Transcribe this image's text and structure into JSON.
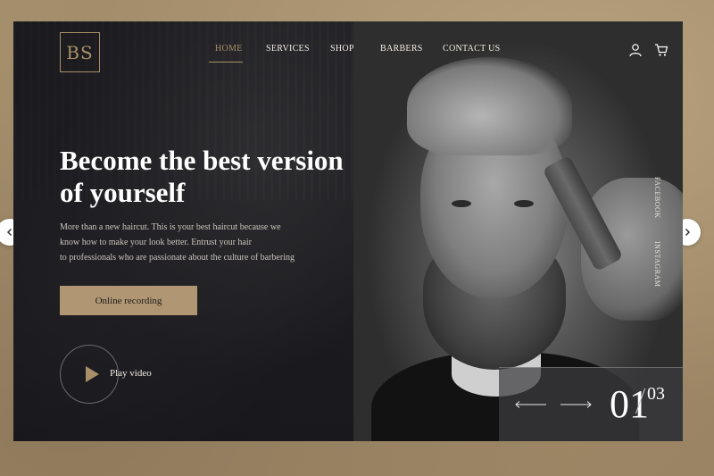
{
  "brand": {
    "logo_text": "BS"
  },
  "nav": {
    "items": [
      {
        "label": "HOME",
        "active": true
      },
      {
        "label": "SERVICES",
        "active": false
      },
      {
        "label": "SHOP",
        "active": false
      },
      {
        "label": "BARBERS",
        "active": false
      },
      {
        "label": "CONTACT US",
        "active": false
      }
    ],
    "icons": [
      "user-icon",
      "cart-icon"
    ]
  },
  "hero": {
    "title": "Become the best version of yourself",
    "description": "More than a new haircut. This is your best haircut because we\nknow how to make your look better. Entrust your hair\n to professionals who are passionate about the culture of barbering",
    "cta_label": "Online recording",
    "play_label": "Play video"
  },
  "social": {
    "facebook": "FACEBOOK",
    "instagram": "INSTAGRAM"
  },
  "slider": {
    "current": "01",
    "total": "03"
  },
  "colors": {
    "accent": "#a88f67",
    "button": "#b09673",
    "panel": "#1c1c20",
    "backdrop": "#a08b6a"
  }
}
